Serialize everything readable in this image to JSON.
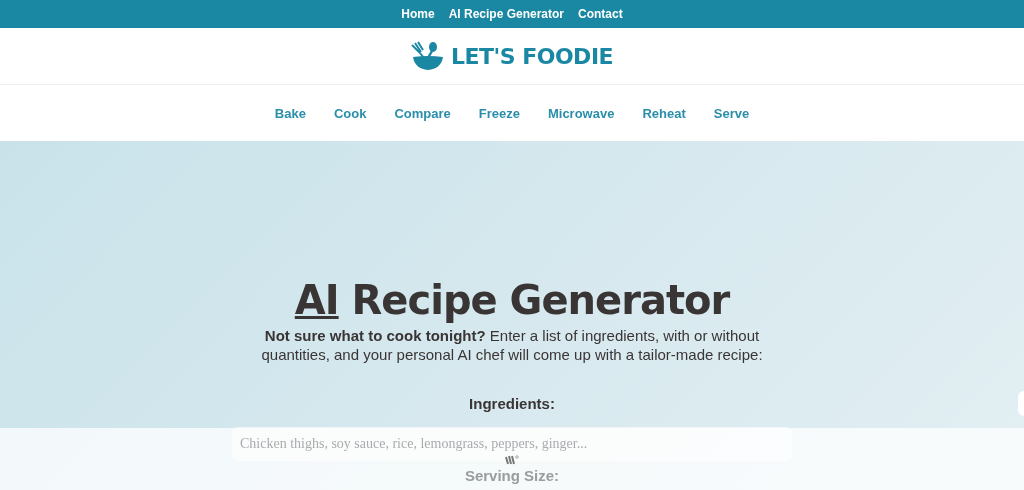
{
  "top_menu": [
    {
      "label": "Home"
    },
    {
      "label": "AI Recipe Generator"
    },
    {
      "label": "Contact"
    }
  ],
  "logo": {
    "text": "LET'S FOODIE"
  },
  "nav": [
    {
      "label": "Bake"
    },
    {
      "label": "Cook"
    },
    {
      "label": "Compare"
    },
    {
      "label": "Freeze"
    },
    {
      "label": "Microwave"
    },
    {
      "label": "Reheat"
    },
    {
      "label": "Serve"
    }
  ],
  "hero": {
    "title_link": "AI",
    "title_rest": "Recipe Generator",
    "intro": "**Not sure what to cook tonight?** Enter a list of ingredients, with or without quantities, and your personal AI chef will come up with a tailor-made recipe:"
  },
  "form": {
    "ingredients_label": "Ingredients:",
    "ingredients_placeholder": "Chicken thighs, soy sauce, rice, lemongrass, peppers, ginger...",
    "serving_label": "Serving Size:"
  }
}
